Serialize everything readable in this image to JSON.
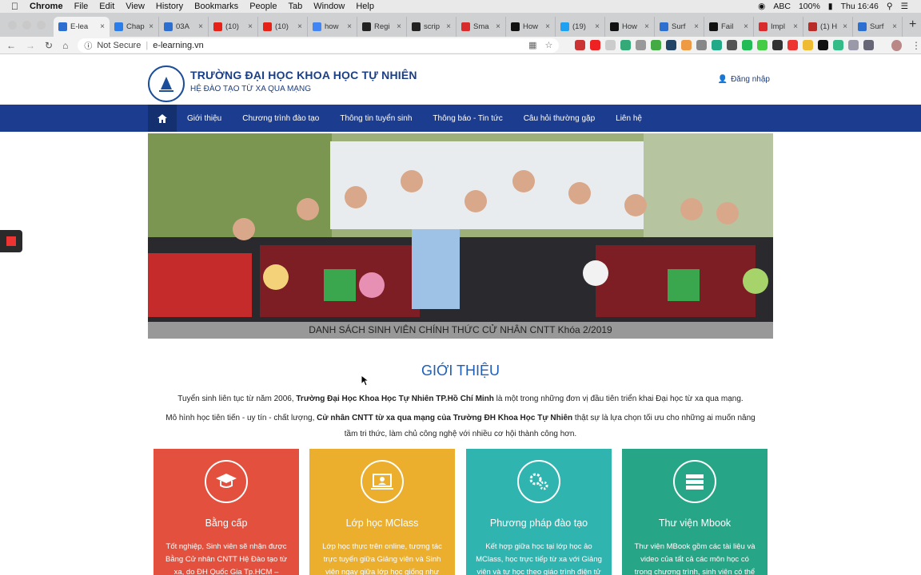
{
  "macos": {
    "app": "Chrome",
    "menus": [
      "File",
      "Edit",
      "View",
      "History",
      "Bookmarks",
      "People",
      "Tab",
      "Window",
      "Help"
    ],
    "input_source": "ABC",
    "battery": "100%",
    "clock": "Thu 16:46"
  },
  "tabs": [
    {
      "label": "E-lea",
      "color": "#2d6fd1",
      "active": true
    },
    {
      "label": "Chap",
      "color": "#2b7de9"
    },
    {
      "label": "03A",
      "color": "#2d6fd1"
    },
    {
      "label": "(10)",
      "color": "#e62117"
    },
    {
      "label": "(10)",
      "color": "#e62117"
    },
    {
      "label": "how",
      "color": "#4285f4"
    },
    {
      "label": "Regi",
      "color": "#222222"
    },
    {
      "label": "scrip",
      "color": "#222222"
    },
    {
      "label": "Sma",
      "color": "#d92b2b"
    },
    {
      "label": "How",
      "color": "#111111"
    },
    {
      "label": "(19)",
      "color": "#1da1f2"
    },
    {
      "label": "How",
      "color": "#111111"
    },
    {
      "label": "Surf",
      "color": "#2d6fd1"
    },
    {
      "label": "Fail",
      "color": "#111111"
    },
    {
      "label": "Impl",
      "color": "#d92b2b"
    },
    {
      "label": "(1) H",
      "color": "#b92b27"
    },
    {
      "label": "Surf",
      "color": "#2d6fd1"
    }
  ],
  "omnibox": {
    "security": "Not Secure",
    "url": "e-learning.vn"
  },
  "site": {
    "title": "TRƯỜNG ĐẠI HỌC KHOA HỌC TỰ NHIÊN",
    "subtitle": "HỆ ĐÀO TẠO TỪ XA QUA MẠNG",
    "login": "Đăng nhập"
  },
  "nav": [
    "Giới thiệu",
    "Chương trình đào tạo",
    "Thông tin tuyển sinh",
    "Thông báo - Tin tức",
    "Câu hỏi thường gặp",
    "Liên hệ"
  ],
  "banner": {
    "caption": "DANH SÁCH SINH VIÊN CHÍNH THỨC CỬ NHÂN CNTT Khóa 2/2019"
  },
  "intro": {
    "heading": "GIỚI THIỆU",
    "p1_pre": "Tuyển sinh liên tục từ năm 2006, ",
    "p1_bold": "Trường Đại Học Khoa Học Tự Nhiên TP.Hồ Chí Minh",
    "p1_post": " là một trong những đơn vị đầu tiên triển khai Đại học từ xa qua mạng.",
    "p2_pre": "Mô hình học tiên tiến - uy tín - chất lượng, ",
    "p2_bold": "Cử nhân CNTT từ xa qua mạng của Trường ĐH Khoa Học Tự Nhiên",
    "p2_post": " thật sự là lựa chọn tối ưu cho những ai muốn nâng tầm tri thức, làm chủ công nghệ với nhiều cơ hội thành công hơn."
  },
  "cards": [
    {
      "title": "Bằng cấp",
      "desc": "Tốt nghiệp, Sinh viên sẽ nhận được Bằng Cử nhân CNTT Hệ Đào tạo từ xa, do ĐH Quốc Gia Tp.HCM – Trường ĐH",
      "color": "#e4503e",
      "icon": "graduation-cap-icon"
    },
    {
      "title": "Lớp học MClass",
      "desc": "Lớp học thực trên online, tương tác trực tuyến giữa Giảng viên và Sinh viên ngay giữa lớp học giống như",
      "color": "#ebae2d",
      "icon": "laptop-teacher-icon"
    },
    {
      "title": "Phương pháp đào tạo",
      "desc": "Kết hợp giữa học tại lớp học ảo MClass, học trực tiếp từ xa với Giảng viên và tự học theo giáo trình điện tử",
      "color": "#2fb4b0",
      "icon": "gears-icon"
    },
    {
      "title": "Thư viện Mbook",
      "desc": "Thư viện MBook gồm các tài liệu và video của tất cả các môn học có trong chương trình, sinh viên có thể tự học",
      "color": "#26a686",
      "icon": "books-icon"
    }
  ]
}
